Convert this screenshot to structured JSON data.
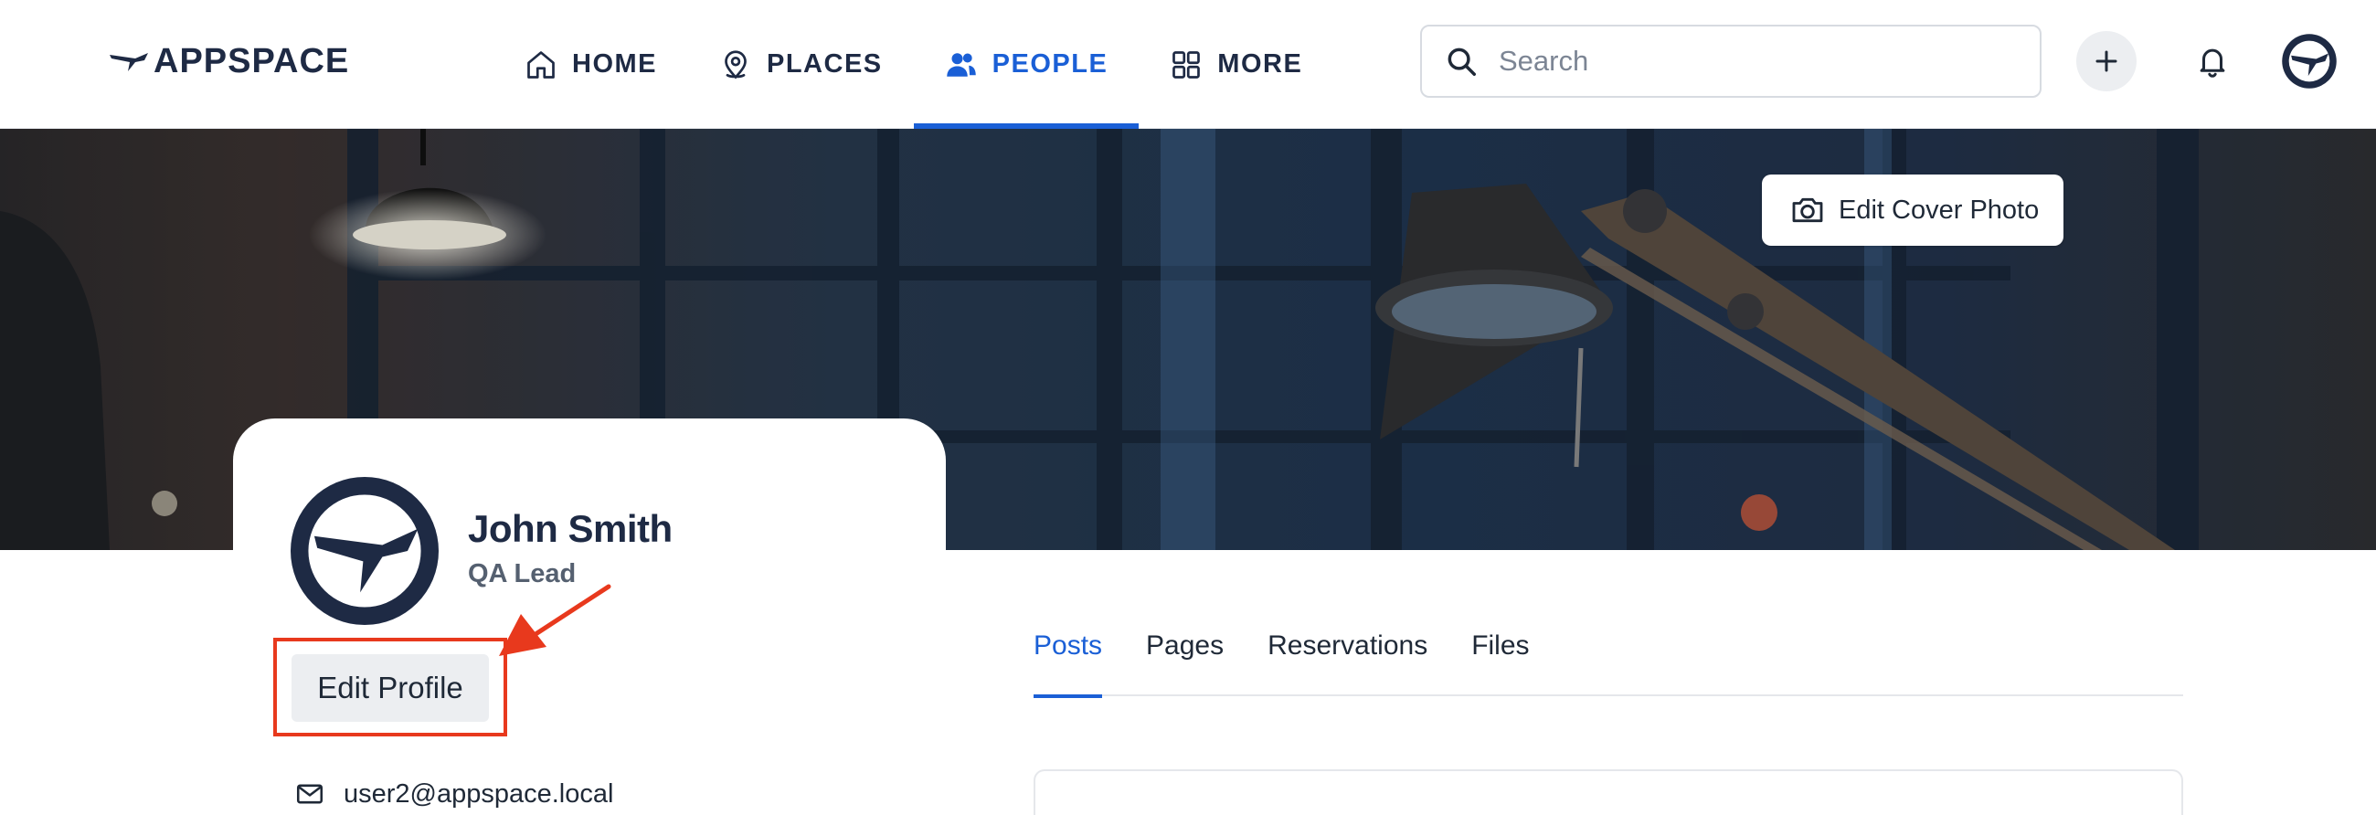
{
  "app": {
    "logo_text": "APPSPACE"
  },
  "nav": {
    "items": [
      {
        "label": "HOME",
        "icon": "home-icon",
        "active": false
      },
      {
        "label": "PLACES",
        "icon": "map-pin-icon",
        "active": false
      },
      {
        "label": "PEOPLE",
        "icon": "people-icon",
        "active": true
      },
      {
        "label": "MORE",
        "icon": "grid-icon",
        "active": false
      }
    ],
    "active_color": "#1a5fd6"
  },
  "search": {
    "placeholder": "Search",
    "value": ""
  },
  "header_actions": {
    "add_icon": "plus-icon",
    "notifications_icon": "bell-icon",
    "avatar_icon": "avatar-icon"
  },
  "cover": {
    "edit_label": "Edit Cover Photo",
    "edit_icon": "camera-icon"
  },
  "profile": {
    "name": "John Smith",
    "title": "QA Lead",
    "edit_label": "Edit Profile",
    "email": "user2@appspace.local",
    "email_icon": "mail-icon"
  },
  "annotation": {
    "highlight_color": "#e8391d"
  },
  "tabs": [
    {
      "label": "Posts",
      "active": true
    },
    {
      "label": "Pages",
      "active": false
    },
    {
      "label": "Reservations",
      "active": false
    },
    {
      "label": "Files",
      "active": false
    }
  ]
}
